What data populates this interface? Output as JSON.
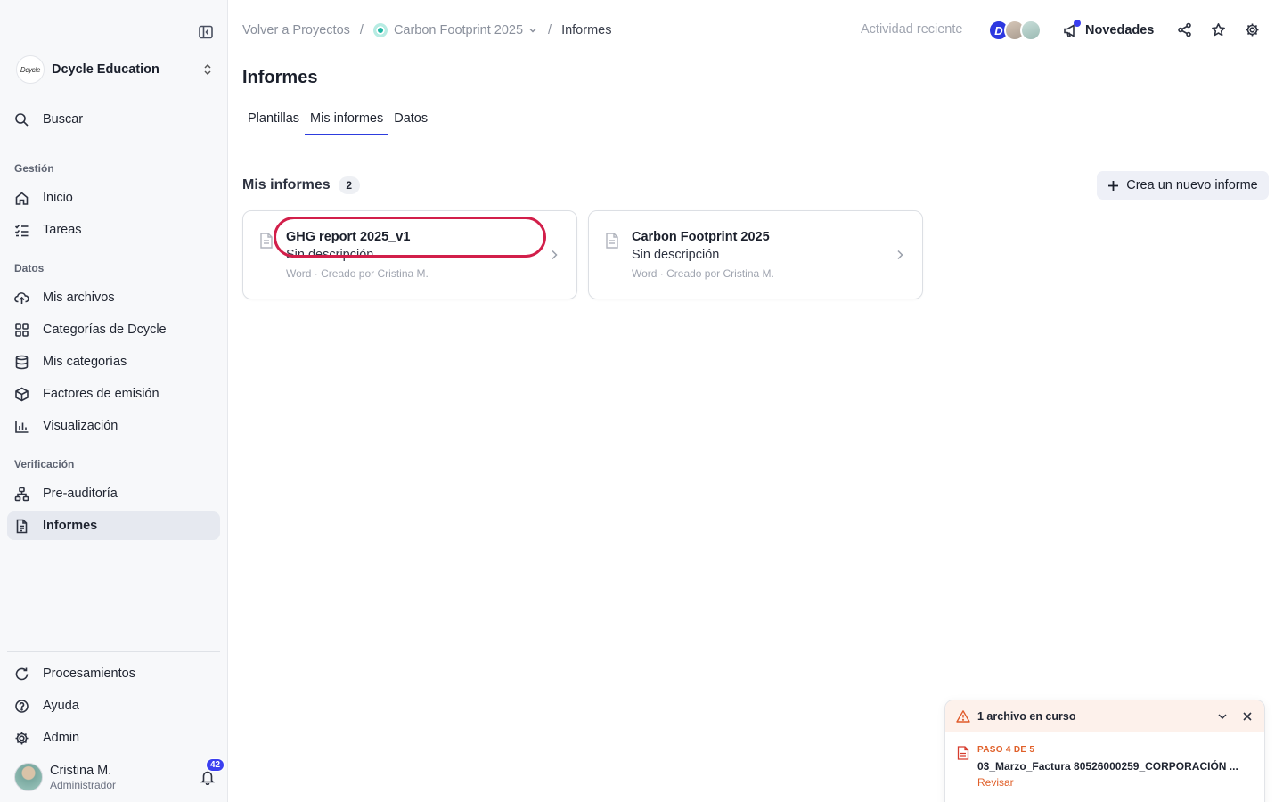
{
  "workspace": {
    "logo_text": "Dcycle",
    "name": "Dcycle Education"
  },
  "sidebar": {
    "search": "Buscar",
    "sections": {
      "gestion": "Gestión",
      "datos": "Datos",
      "verificacion": "Verificación"
    },
    "items": {
      "inicio": "Inicio",
      "tareas": "Tareas",
      "mis_archivos": "Mis archivos",
      "categorias_dcycle": "Categorías de Dcycle",
      "mis_categorias": "Mis categorías",
      "factores": "Factores de emisión",
      "visualizacion": "Visualización",
      "preauditoria": "Pre-auditoría",
      "informes": "Informes",
      "procesamientos": "Procesamientos",
      "ayuda": "Ayuda",
      "admin": "Admin"
    }
  },
  "user": {
    "name": "Cristina M.",
    "role": "Administrador",
    "notifications": "42"
  },
  "breadcrumb": {
    "back": "Volver a Proyectos",
    "project": "Carbon Footprint 2025",
    "current": "Informes"
  },
  "topbar": {
    "activity": "Actividad reciente",
    "avatar_initial": "D",
    "news": "Novedades"
  },
  "page": {
    "title": "Informes",
    "tabs": [
      "Plantillas",
      "Mis informes",
      "Datos"
    ],
    "section_title": "Mis informes",
    "section_count": "2",
    "new_button": "Crea un nuevo informe"
  },
  "reports": [
    {
      "title": "GHG report 2025_v1",
      "description": "Sin descripción",
      "meta": "Word · Creado por Cristina M."
    },
    {
      "title": "Carbon Footprint 2025",
      "description": "Sin descripción",
      "meta": "Word · Creado por Cristina M."
    }
  ],
  "toast": {
    "title": "1 archivo en curso",
    "step": "PASO 4 DE 5",
    "filename": "03_Marzo_Factura 80526000259_CORPORACIÓN ...",
    "action": "Revisar"
  },
  "colors": {
    "accent": "#2d3cde",
    "highlight": "#d21f4a",
    "warning": "#e0602a",
    "badge": "#3b3ff0"
  }
}
